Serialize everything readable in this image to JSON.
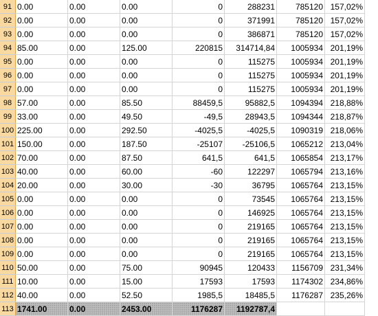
{
  "rows": [
    {
      "num": "91",
      "c": [
        "0.00",
        "0.00",
        "0.00",
        "0",
        "288231",
        "785120",
        "157,02%"
      ]
    },
    {
      "num": "92",
      "c": [
        "0.00",
        "0.00",
        "0.00",
        "0",
        "371991",
        "785120",
        "157,02%"
      ]
    },
    {
      "num": "93",
      "c": [
        "0.00",
        "0.00",
        "0.00",
        "0",
        "386871",
        "785120",
        "157,02%"
      ]
    },
    {
      "num": "94",
      "c": [
        "85.00",
        "0.00",
        "125.00",
        "220815",
        "314714,84",
        "1005934",
        "201,19%"
      ]
    },
    {
      "num": "95",
      "c": [
        "0.00",
        "0.00",
        "0.00",
        "0",
        "115275",
        "1005934",
        "201,19%"
      ]
    },
    {
      "num": "96",
      "c": [
        "0.00",
        "0.00",
        "0.00",
        "0",
        "115275",
        "1005934",
        "201,19%"
      ]
    },
    {
      "num": "97",
      "c": [
        "0.00",
        "0.00",
        "0.00",
        "0",
        "115275",
        "1005934",
        "201,19%"
      ]
    },
    {
      "num": "98",
      "c": [
        "57.00",
        "0.00",
        "85.50",
        "88459,5",
        "95882,5",
        "1094394",
        "218,88%"
      ]
    },
    {
      "num": "99",
      "c": [
        "33.00",
        "0.00",
        "49.50",
        "-49,5",
        "28943,5",
        "1094344",
        "218,87%"
      ]
    },
    {
      "num": "100",
      "c": [
        "225.00",
        "0.00",
        "292.50",
        "-4025,5",
        "-4025,5",
        "1090319",
        "218,06%"
      ]
    },
    {
      "num": "101",
      "c": [
        "150.00",
        "0.00",
        "187.50",
        "-25107",
        "-25106,5",
        "1065212",
        "213,04%"
      ]
    },
    {
      "num": "102",
      "c": [
        "70.00",
        "0.00",
        "87.50",
        "641,5",
        "641,5",
        "1065854",
        "213,17%"
      ]
    },
    {
      "num": "103",
      "c": [
        "40.00",
        "0.00",
        "60.00",
        "-60",
        "122297",
        "1065794",
        "213,16%"
      ]
    },
    {
      "num": "104",
      "c": [
        "20.00",
        "0.00",
        "30.00",
        "-30",
        "36795",
        "1065764",
        "213,15%"
      ]
    },
    {
      "num": "105",
      "c": [
        "0.00",
        "0.00",
        "0.00",
        "0",
        "73545",
        "1065764",
        "213,15%"
      ]
    },
    {
      "num": "106",
      "c": [
        "0.00",
        "0.00",
        "0.00",
        "0",
        "146925",
        "1065764",
        "213,15%"
      ]
    },
    {
      "num": "107",
      "c": [
        "0.00",
        "0.00",
        "0.00",
        "0",
        "219165",
        "1065764",
        "213,15%"
      ]
    },
    {
      "num": "108",
      "c": [
        "0.00",
        "0.00",
        "0.00",
        "0",
        "219165",
        "1065764",
        "213,15%"
      ]
    },
    {
      "num": "109",
      "c": [
        "0.00",
        "0.00",
        "0.00",
        "0",
        "219165",
        "1065764",
        "213,15%"
      ]
    },
    {
      "num": "110",
      "c": [
        "50.00",
        "0.00",
        "75.00",
        "90945",
        "120433",
        "1156709",
        "231,34%"
      ]
    },
    {
      "num": "111",
      "c": [
        "10.00",
        "0.00",
        "15.00",
        "17593",
        "17593",
        "1174302",
        "234,86%"
      ]
    },
    {
      "num": "112",
      "c": [
        "40.00",
        "0.00",
        "52.50",
        "1985,5",
        "18485,5",
        "1176287",
        "235,26%"
      ]
    }
  ],
  "total_row": {
    "num": "113",
    "c": [
      "1741.00",
      "0.00",
      "2453.00",
      "1176287",
      "1192787,4",
      "",
      ""
    ]
  },
  "columns": {
    "widths": [
      22,
      76,
      76,
      76,
      76,
      76,
      70,
      58
    ]
  },
  "colors": {
    "row_header_bg": "#e6e9ee",
    "selected_row_header_bg": "#f9d99f",
    "gridline": "#d4d4d4",
    "total_fill": "#bfbfbf"
  }
}
